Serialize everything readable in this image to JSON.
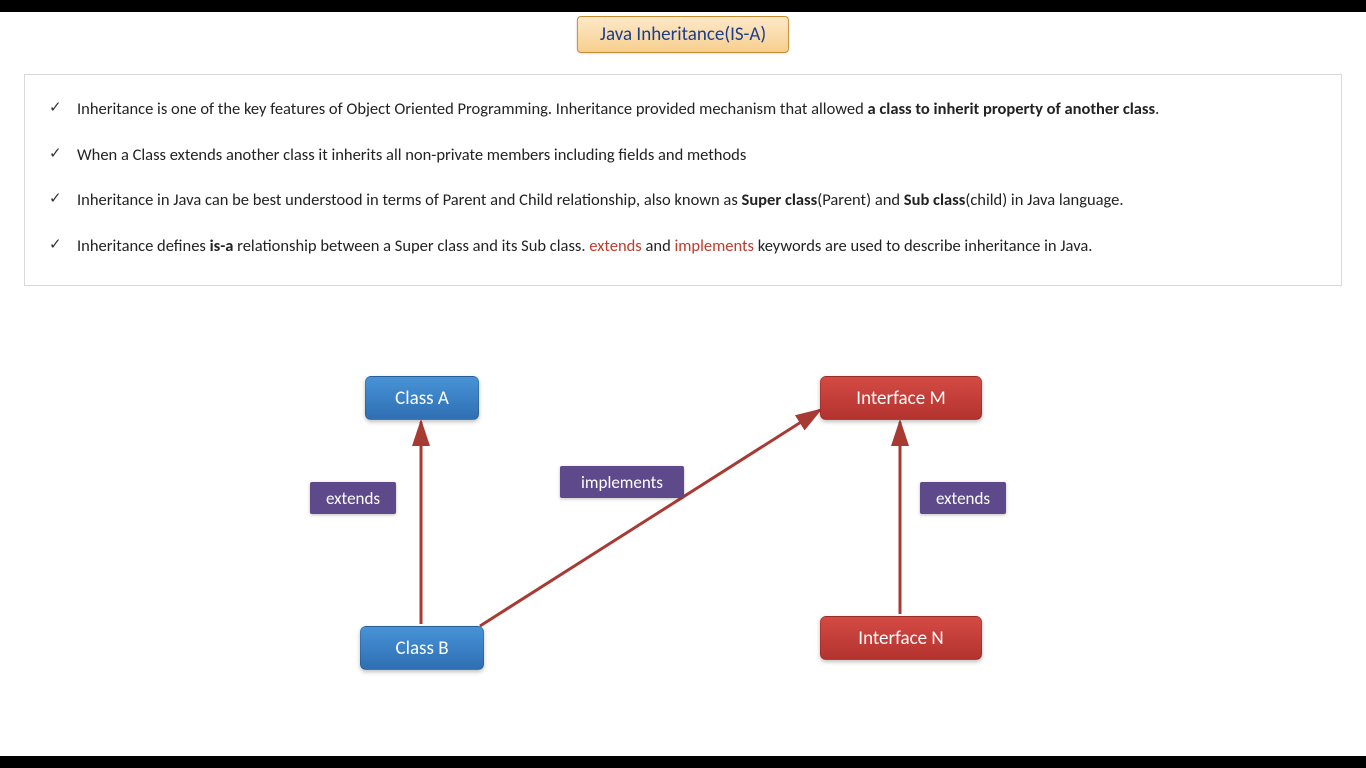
{
  "title": "Java Inheritance(IS-A)",
  "bullets": [
    {
      "segments": [
        {
          "text": "Inheritance is one of the key features of Object Oriented Programming. Inheritance provided mechanism that allowed "
        },
        {
          "text": "a class to inherit property of another class",
          "bold": true
        },
        {
          "text": "."
        }
      ]
    },
    {
      "segments": [
        {
          "text": "When a Class extends another class it inherits all non-private members including fields and methods"
        }
      ]
    },
    {
      "segments": [
        {
          "text": "Inheritance in Java can be best understood in terms of Parent and Child relationship, also known as "
        },
        {
          "text": "Super class",
          "bold": true
        },
        {
          "text": "(Parent) and "
        },
        {
          "text": "Sub class",
          "bold": true
        },
        {
          "text": "(child) in Java language."
        }
      ]
    },
    {
      "segments": [
        {
          "text": "Inheritance defines "
        },
        {
          "text": "is-a",
          "bold": true
        },
        {
          "text": " relationship between a Super class and its Sub class. "
        },
        {
          "text": "extends",
          "keyword": true
        },
        {
          "text": " and "
        },
        {
          "text": "implements",
          "keyword": true
        },
        {
          "text": " keywords are used to describe inheritance in Java."
        }
      ]
    }
  ],
  "diagram": {
    "nodes": {
      "classA": {
        "label": "Class A",
        "kind": "class"
      },
      "classB": {
        "label": "Class B",
        "kind": "class"
      },
      "interfaceM": {
        "label": "Interface  M",
        "kind": "interface"
      },
      "interfaceN": {
        "label": "Interface  N",
        "kind": "interface"
      }
    },
    "edges": [
      {
        "from": "classB",
        "to": "classA",
        "label": "extends"
      },
      {
        "from": "classB",
        "to": "interfaceM",
        "label": "implements"
      },
      {
        "from": "interfaceN",
        "to": "interfaceM",
        "label": "extends"
      }
    ]
  }
}
